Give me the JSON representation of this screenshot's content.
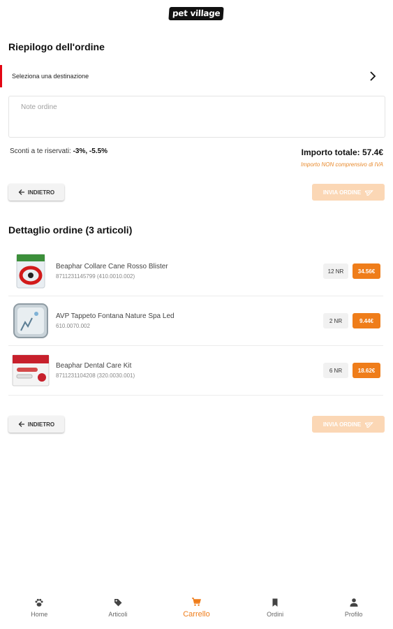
{
  "header": {
    "logo_text": "pet village"
  },
  "summary": {
    "title": "Riepilogo dell'ordine",
    "destination_label": "Seleziona una destinazione",
    "notes_placeholder": "Note ordine",
    "discounts_prefix": "Sconti a te riservati:",
    "discounts_value": "-3%, -5.5%",
    "total_label": "Importo totale: 57.4€",
    "vat_note": "Importo NON comprensivo di IVA"
  },
  "actions": {
    "back_label": "INDIETRO",
    "send_label": "INVIA ORDINE",
    "send_enabled": false
  },
  "detail": {
    "title": "Dettaglio ordine (3 articoli)",
    "items": [
      {
        "name": "Beaphar Collare Cane Rosso Blister",
        "code": "8711231145799 (410.0010.002)",
        "qty": "12 NR",
        "price": "34.56€",
        "thumb_icon": "collar-product-image"
      },
      {
        "name": "AVP Tappeto Fontana Nature Spa Led",
        "code": "610.0070.002",
        "qty": "2 NR",
        "price": "9.44€",
        "thumb_icon": "fountain-mat-product-image"
      },
      {
        "name": "Beaphar Dental Care Kit",
        "code": "8711231104208 (320.0030.001)",
        "qty": "6 NR",
        "price": "18.62€",
        "thumb_icon": "dental-kit-product-image"
      }
    ]
  },
  "nav": {
    "items": [
      {
        "label": "Home",
        "icon": "paw-icon",
        "active": false
      },
      {
        "label": "Articoli",
        "icon": "tag-icon",
        "active": false
      },
      {
        "label": "Carrello",
        "icon": "cart-icon",
        "active": true
      },
      {
        "label": "Ordini",
        "icon": "bookmark-icon",
        "active": false
      },
      {
        "label": "Profilo",
        "icon": "person-icon",
        "active": false
      }
    ]
  },
  "colors": {
    "accent": "#ef7d1a",
    "accent_disabled": "#fbd7b5",
    "destination_marker": "#e30613"
  }
}
